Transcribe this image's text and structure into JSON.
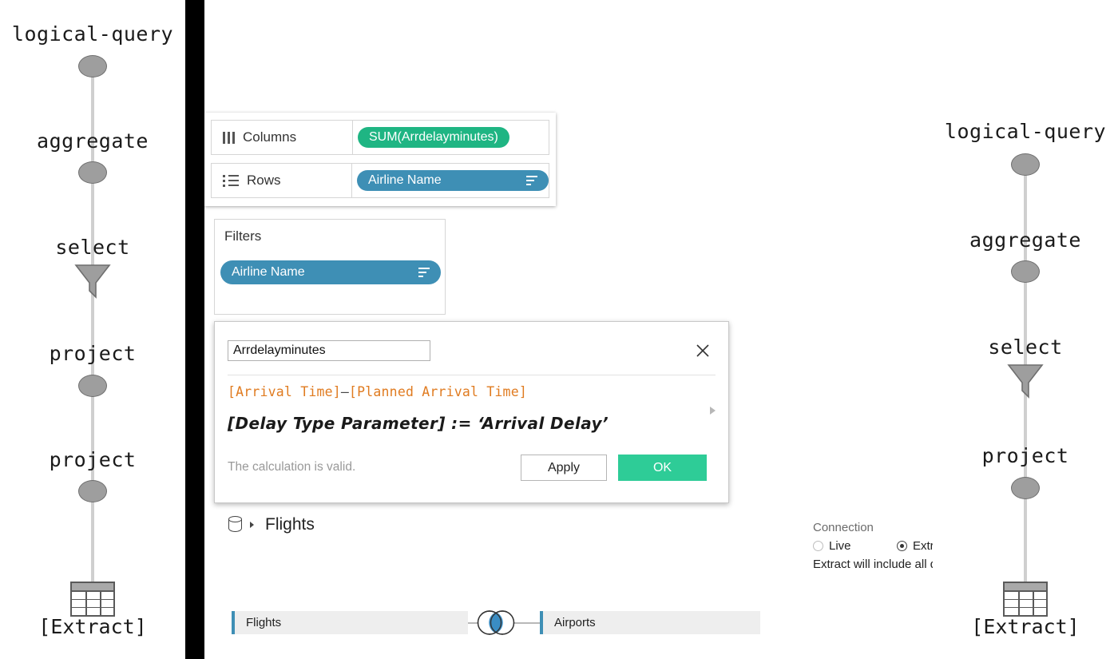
{
  "left_pipeline": {
    "title": "logical-query",
    "steps": [
      {
        "label": "logical-query",
        "icon": "ellipse-node-icon"
      },
      {
        "label": "aggregate",
        "icon": "ellipse-node-icon"
      },
      {
        "label": "select",
        "icon": "funnel-icon"
      },
      {
        "label": "project",
        "icon": "ellipse-node-icon"
      },
      {
        "label": "project",
        "icon": "ellipse-node-icon"
      }
    ],
    "source_label": "[Extract]",
    "source_icon": "table-icon"
  },
  "right_pipeline": {
    "title": "logical-query",
    "steps": [
      {
        "label": "logical-query",
        "icon": "ellipse-node-icon"
      },
      {
        "label": "aggregate",
        "icon": "ellipse-node-icon"
      },
      {
        "label": "select",
        "icon": "funnel-icon"
      },
      {
        "label": "project",
        "icon": "ellipse-node-icon"
      }
    ],
    "source_label": "[Extract]",
    "source_icon": "table-icon"
  },
  "shelves": {
    "columns": {
      "label": "Columns",
      "icon": "columns-icon",
      "pill": {
        "text": "SUM(Arrdelayminutes)",
        "color": "#1fb583",
        "kind": "measure"
      }
    },
    "rows": {
      "label": "Rows",
      "icon": "rows-icon",
      "pill": {
        "text": "Airline Name",
        "color": "#3e8fb5",
        "kind": "dimension",
        "sort": "sort-descending-icon"
      }
    }
  },
  "filters": {
    "title": "Filters",
    "pill": {
      "text": "Airline Name",
      "color": "#3e8fb5",
      "sort": "sort-descending-icon"
    }
  },
  "calculation": {
    "name": "Arrdelayminutes",
    "close_icon": "close-icon",
    "expression_line1_left": "[Arrival Time]",
    "expression_line1_op": "–",
    "expression_line1_right": "[Planned Arrival Time]",
    "expression_line2": "[Delay Type Parameter] := ‘Arrival Delay’",
    "status": "The calculation is valid.",
    "apply_label": "Apply",
    "ok_label": "OK",
    "ok_color": "#2ecc97",
    "scroll_icon": "scroll-right-arrow-icon"
  },
  "datasource": {
    "icon": "database-cylinder-icon",
    "caret": "caret-down-icon",
    "name": "Flights"
  },
  "join": {
    "left_table": "Flights",
    "right_table": "Airports",
    "join_icon": "inner-join-venn-icon",
    "join_color": "#3a8dc4"
  },
  "connection": {
    "title": "Connection",
    "options": [
      {
        "label": "Live",
        "selected": false
      },
      {
        "label": "Extract",
        "selected": true
      }
    ],
    "note": "Extract will include all data."
  }
}
